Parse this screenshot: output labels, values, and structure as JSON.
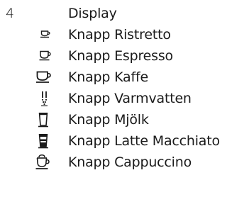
{
  "legend": {
    "header": {
      "number": "4",
      "label": "Display"
    },
    "items": [
      {
        "icon": "ristretto-cup-icon",
        "label": "Knapp Ristretto"
      },
      {
        "icon": "espresso-cup-icon",
        "label": "Knapp Espresso"
      },
      {
        "icon": "coffee-cup-icon",
        "label": "Knapp Kaffe"
      },
      {
        "icon": "hot-water-icon",
        "label": "Knapp Varmvatten"
      },
      {
        "icon": "milk-glass-icon",
        "label": "Knapp Mjölk"
      },
      {
        "icon": "latte-macchiato-glass-icon",
        "label": "Knapp Latte Macchiato"
      },
      {
        "icon": "cappuccino-cup-icon",
        "label": "Knapp Cappuccino"
      }
    ]
  }
}
